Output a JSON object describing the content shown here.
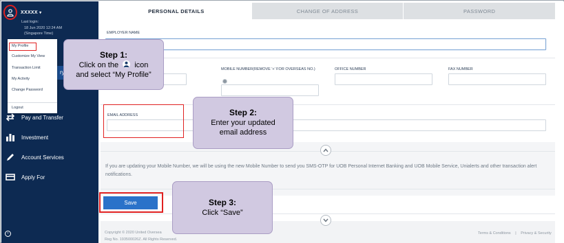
{
  "sidebar": {
    "username": "XXXXX",
    "last_login_label": "Last login:",
    "last_login_datetime": "18 Jun 2020 12:24 AM",
    "last_login_tz": "(Singapore Time)",
    "dropdown": [
      "My Profile",
      "Customize My View",
      "Transaction Limit",
      "My Activity",
      "Change Password",
      "Logout"
    ],
    "partial_nav_label": "ry",
    "nav": [
      {
        "label": "Pay and Transfer",
        "icon": "transfer-icon"
      },
      {
        "label": "Investment",
        "icon": "bar-chart-icon"
      },
      {
        "label": "Account Services",
        "icon": "pencil-icon"
      },
      {
        "label": "Apply For",
        "icon": "card-icon"
      }
    ],
    "collapse_glyph": "‹"
  },
  "tabs": [
    {
      "label": "PERSONAL DETAILS",
      "active": true
    },
    {
      "label": "CHANGE OF ADDRESS",
      "active": false
    },
    {
      "label": "PASSWORD",
      "active": false
    }
  ],
  "form": {
    "employer_name_label": "EMPLOYER NAME",
    "mobile_label": "MOBILE NUMBER(REMOVE '+' FOR OVERSEAS NO.)",
    "office_label": "OFFICE NUMBER",
    "fax_label": "FAX NUMBER",
    "email_label": "EMAIL ADDRESS"
  },
  "notice": "If you are updating your Mobile Number, we will be using the new Mobile Number to send you SMS-OTP for UOB Personal Internet Banking and UOB Mobile Service, Unialerts and other transaction alert notifications.",
  "save_label": "Save",
  "footer": {
    "copyright": "Copyright © 2020 United Oversea",
    "reg_no": "Reg No. 193500026Z. All Rights Reserved.",
    "terms": "Terms & Conditions",
    "separator": "|",
    "privacy": "Privacy & Security"
  },
  "callouts": {
    "step1_title": "Step 1:",
    "step1_line1_pre": "Click on the",
    "step1_line1_post": "icon",
    "step1_line2": "and select “My Profile”",
    "step2_title": "Step 2:",
    "step2_line1": "Enter your updated",
    "step2_line2": "email address",
    "step3_title": "Step 3:",
    "step3_line1": "Click “Save”"
  },
  "colors": {
    "sidebar_bg": "#0d2a52",
    "accent": "#2a72c9",
    "highlight": "#e02020",
    "callout_bg": "#d1c9e1"
  }
}
